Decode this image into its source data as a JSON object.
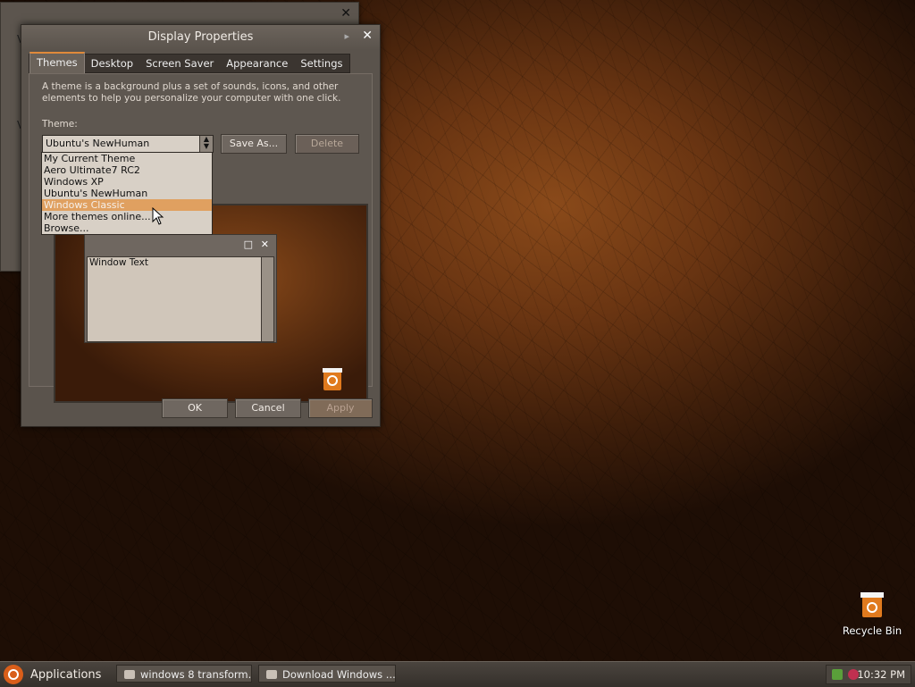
{
  "back_window": {
    "letters": [
      "V",
      "V"
    ]
  },
  "dialog": {
    "title": "Display Properties",
    "tabs": [
      "Themes",
      "Desktop",
      "Screen Saver",
      "Appearance",
      "Settings"
    ],
    "description": "A theme is a background plus a set of sounds, icons, and other elements to help you personalize your computer with one click.",
    "theme_label": "Theme:",
    "theme_value": "Ubuntu's NewHuman",
    "save_as_label": "Save As...",
    "delete_label": "Delete",
    "theme_options": [
      "My Current Theme",
      "Aero Ultimate7 RC2",
      "Windows XP",
      "Ubuntu's NewHuman",
      "Windows Classic",
      "More themes online...",
      "Browse..."
    ],
    "selected_option": "Windows Classic",
    "preview": {
      "window_text": "Window Text"
    },
    "ok_label": "OK",
    "cancel_label": "Cancel",
    "apply_label": "Apply"
  },
  "desktop": {
    "recycle_bin_label": "Recycle Bin"
  },
  "taskbar": {
    "start_label": "Applications",
    "tasks": [
      "windows 8 transform...",
      "Download Windows ..."
    ],
    "clock": "10:32 PM"
  },
  "colors": {
    "accent": "#e08a3a",
    "selection": "#e0a060",
    "window_bg": "#5a534c"
  }
}
